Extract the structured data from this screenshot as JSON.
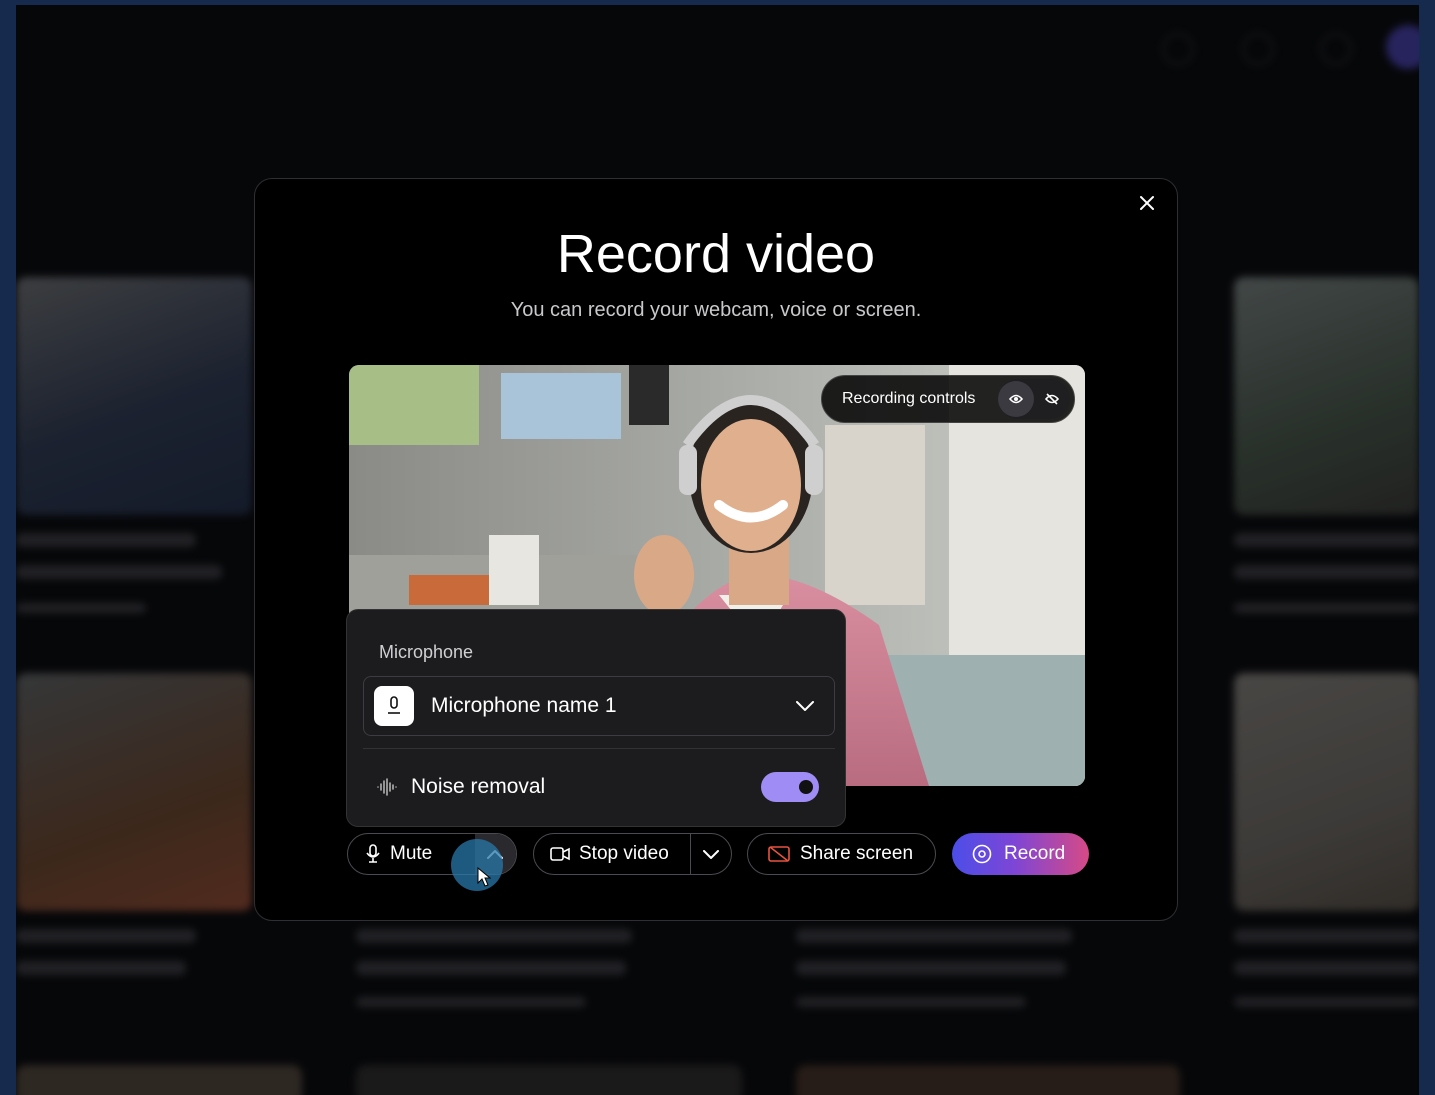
{
  "modal": {
    "title": "Record video",
    "subtitle": "You can record your webcam, voice or screen."
  },
  "preview": {
    "recording_controls_label": "Recording controls"
  },
  "microphone_popover": {
    "label": "Microphone",
    "selected_device": "Microphone name 1",
    "noise_removal_label": "Noise removal",
    "noise_removal_enabled": true
  },
  "toolbar": {
    "mute_label": "Mute",
    "stop_video_label": "Stop video",
    "share_screen_label": "Share screen",
    "record_label": "Record"
  },
  "colors": {
    "accent_toggle": "#9f8cf5",
    "record_gradient_start": "#4b4ee8",
    "record_gradient_end": "#d64a86"
  }
}
